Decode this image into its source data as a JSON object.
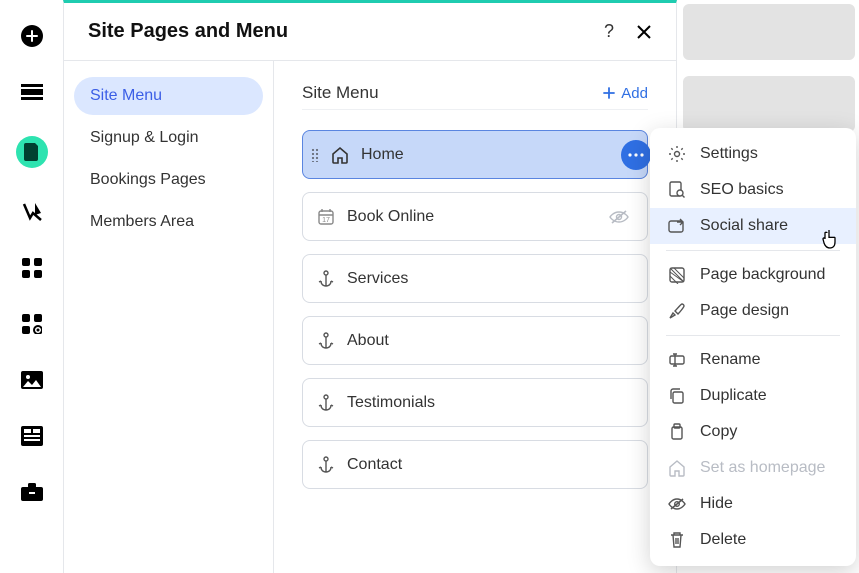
{
  "panel": {
    "title": "Site Pages and Menu"
  },
  "sidebar": {
    "items": [
      {
        "label": "Site Menu"
      },
      {
        "label": "Signup & Login"
      },
      {
        "label": "Bookings Pages"
      },
      {
        "label": "Members Area"
      }
    ]
  },
  "section": {
    "title": "Site Menu",
    "add_label": "Add"
  },
  "pages": [
    {
      "label": "Home"
    },
    {
      "label": "Book Online"
    },
    {
      "label": "Services"
    },
    {
      "label": "About"
    },
    {
      "label": "Testimonials"
    },
    {
      "label": "Contact"
    }
  ],
  "menu": {
    "settings": "Settings",
    "seo": "SEO basics",
    "social": "Social share",
    "page_bg": "Page background",
    "page_design": "Page design",
    "rename": "Rename",
    "duplicate": "Duplicate",
    "copy": "Copy",
    "set_home": "Set as homepage",
    "hide": "Hide",
    "delete": "Delete"
  }
}
